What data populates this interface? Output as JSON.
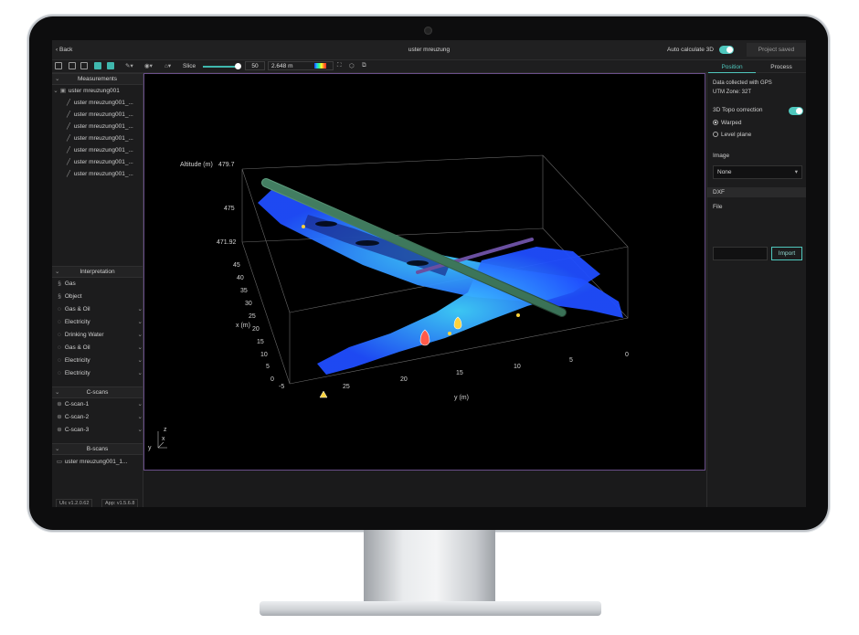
{
  "titlebar": {
    "back": "Back",
    "title": "uster mreuzung",
    "auto_calc": "Auto calculate 3D",
    "saved": "Project saved"
  },
  "toolbar": {
    "slice_label": "Slice",
    "slice_value": "50",
    "depth": "2.648 m"
  },
  "tabs": [
    "Position",
    "Process"
  ],
  "left": {
    "measurements_header": "Measurements",
    "project": "uster mreuzung001",
    "files": [
      "uster mreuzung001_...",
      "uster mreuzung001_...",
      "uster mreuzung001_...",
      "uster mreuzung001_...",
      "uster mreuzung001_...",
      "uster mreuzung001_...",
      "uster mreuzung001_..."
    ],
    "interpretation_header": "Interpretation",
    "interpretations": [
      "Gas",
      "Object",
      "Gas & Oil",
      "Electricity",
      "Drinking Water",
      "Gas & Oil",
      "Electricity",
      "Electricity"
    ],
    "cscans_header": "C-scans",
    "cscans": [
      "C-scan-1",
      "C-scan-2",
      "C-scan-3"
    ],
    "bscans_header": "B-scans",
    "bscans": [
      "uster mreuzung001_1..."
    ],
    "version_ui": "UIc v1.2.0.62",
    "version_app": "App: v1.5.6.8"
  },
  "right": {
    "gps": "Data collected with GPS",
    "utm": "UTM Zone: 32T",
    "topo": "3D Topo correction",
    "warped": "Warped",
    "level": "Level plane",
    "image_label": "Image",
    "image_value": "None",
    "dxf_header": "DXF",
    "file_label": "File",
    "import": "Import"
  },
  "plot": {
    "altitude_label": "Altitude (m)",
    "altitude_ticks": [
      "479.7",
      "475",
      "471.92"
    ],
    "x_label": "x (m)",
    "x_ticks": [
      "45",
      "40",
      "35",
      "30",
      "25",
      "20",
      "15",
      "10",
      "5",
      "0",
      "-5"
    ],
    "y_label": "y (m)",
    "y_ticks": [
      "25",
      "20",
      "15",
      "10",
      "5",
      "0"
    ],
    "axis_gizmo": [
      "z",
      "y",
      "x"
    ]
  },
  "colors": {
    "accent": "#4fc7bd",
    "pipe_green": "#3f7a5e",
    "pipe_purple": "#6a4fa0",
    "scan_blue": "#1f57ff"
  },
  "icons": [
    "back-chevron-icon",
    "layout-icons",
    "brush-icon",
    "eye-icon",
    "lock-icon",
    "colormap-icon",
    "fullscreen-icon",
    "cube-icon",
    "export-icon",
    "gas-icon",
    "object-icon",
    "drop-icon",
    "scan-icon"
  ]
}
